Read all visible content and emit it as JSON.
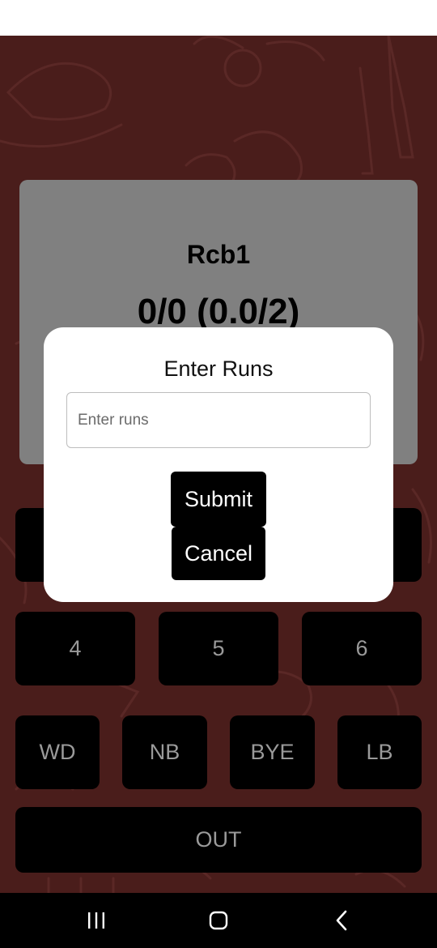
{
  "scoreboard": {
    "team_name": "Rcb1",
    "score": "0/0 (0.0/2)"
  },
  "keypad": {
    "row2": [
      "4",
      "5",
      "6"
    ],
    "extras": [
      "WD",
      "NB",
      "BYE",
      "LB"
    ],
    "out_label": "OUT"
  },
  "dialog": {
    "title": "Enter Runs",
    "input_placeholder": "Enter runs",
    "input_value": "",
    "submit_label": "Submit",
    "cancel_label": "Cancel"
  },
  "nav": {
    "recent_icon": "recent-apps-icon",
    "home_icon": "home-icon",
    "back_icon": "back-icon"
  },
  "colors": {
    "background": "#4a1d1b",
    "card": "#808080",
    "button": "#000000",
    "button_text": "#9a9a9a",
    "dialog": "#ffffff"
  }
}
